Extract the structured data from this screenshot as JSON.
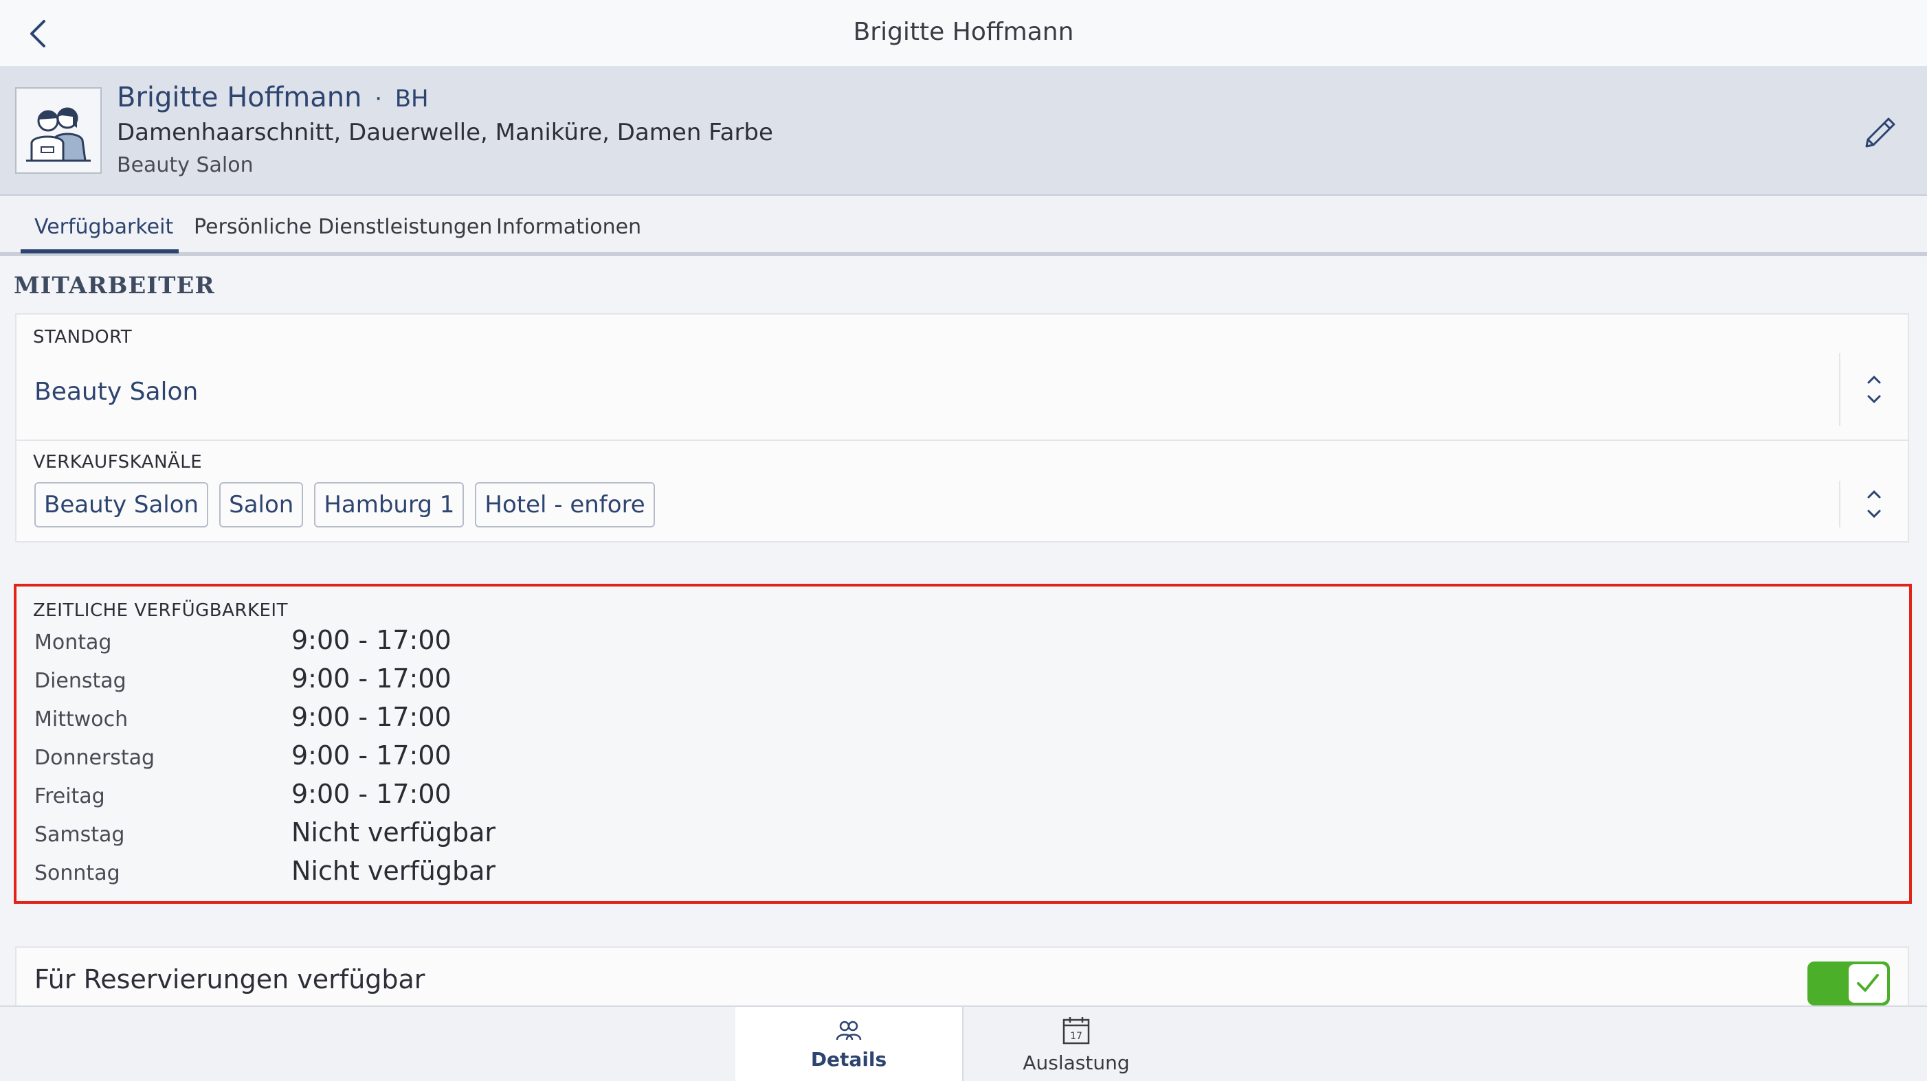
{
  "topbar": {
    "title": "Brigitte Hoffmann"
  },
  "header": {
    "name": "Brigitte Hoffmann",
    "separator": "·",
    "initials": "BH",
    "services": "Damenhaarschnitt, Dauerwelle, Maniküre, Damen Farbe",
    "location": "Beauty Salon"
  },
  "tabs": [
    {
      "label": "Verfügbarkeit",
      "active": true
    },
    {
      "label": "Persönliche Dienstleistungen",
      "active": false
    },
    {
      "label": "Informationen",
      "active": false
    }
  ],
  "section_title": "MITARBEITER",
  "standort": {
    "label": "STANDORT",
    "value": "Beauty Salon"
  },
  "verkaufskanaele": {
    "label": "VERKAUFSKANÄLE",
    "chips": [
      "Beauty Salon",
      "Salon",
      "Hamburg 1",
      "Hotel - enfore"
    ]
  },
  "availability": {
    "title": "ZEITLICHE VERFÜGBARKEIT",
    "days": [
      {
        "day": "Montag",
        "time": "9:00 - 17:00"
      },
      {
        "day": "Dienstag",
        "time": "9:00 - 17:00"
      },
      {
        "day": "Mittwoch",
        "time": "9:00 - 17:00"
      },
      {
        "day": "Donnerstag",
        "time": "9:00 - 17:00"
      },
      {
        "day": "Freitag",
        "time": "9:00 - 17:00"
      },
      {
        "day": "Samstag",
        "time": "Nicht verfügbar"
      },
      {
        "day": "Sonntag",
        "time": "Nicht verfügbar"
      }
    ],
    "highlight_color": "#e2231a"
  },
  "reservation": {
    "label": "Für Reservierungen verfügbar",
    "enabled": true
  },
  "bottom_nav": [
    {
      "label": "Details",
      "icon": "people-icon",
      "active": true
    },
    {
      "label": "Auslastung",
      "icon": "calendar-icon",
      "calendar_day": "17",
      "active": false
    }
  ],
  "colors": {
    "accent": "#2d4470",
    "toggle_on": "#4caf2a"
  }
}
